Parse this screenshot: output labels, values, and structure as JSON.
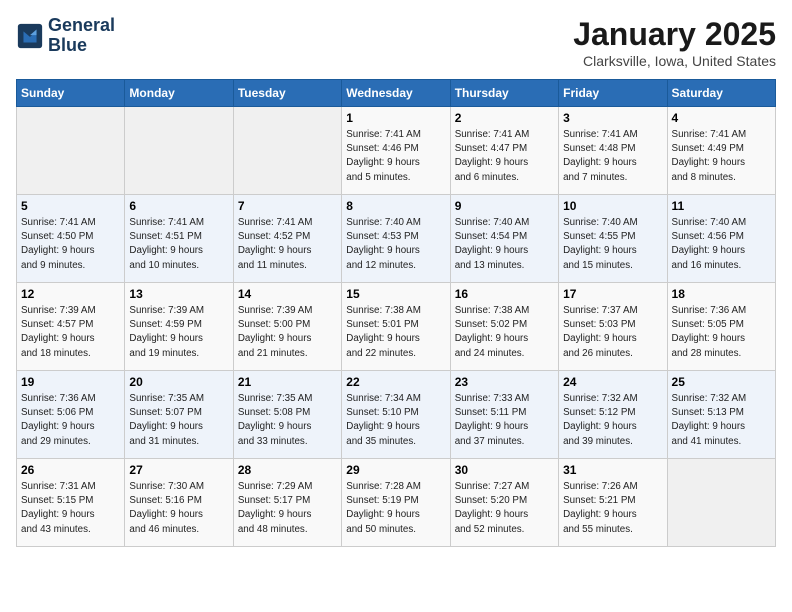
{
  "header": {
    "logo_line1": "General",
    "logo_line2": "Blue",
    "month": "January 2025",
    "location": "Clarksville, Iowa, United States"
  },
  "days_of_week": [
    "Sunday",
    "Monday",
    "Tuesday",
    "Wednesday",
    "Thursday",
    "Friday",
    "Saturday"
  ],
  "weeks": [
    [
      {
        "day": "",
        "info": ""
      },
      {
        "day": "",
        "info": ""
      },
      {
        "day": "",
        "info": ""
      },
      {
        "day": "1",
        "info": "Sunrise: 7:41 AM\nSunset: 4:46 PM\nDaylight: 9 hours\nand 5 minutes."
      },
      {
        "day": "2",
        "info": "Sunrise: 7:41 AM\nSunset: 4:47 PM\nDaylight: 9 hours\nand 6 minutes."
      },
      {
        "day": "3",
        "info": "Sunrise: 7:41 AM\nSunset: 4:48 PM\nDaylight: 9 hours\nand 7 minutes."
      },
      {
        "day": "4",
        "info": "Sunrise: 7:41 AM\nSunset: 4:49 PM\nDaylight: 9 hours\nand 8 minutes."
      }
    ],
    [
      {
        "day": "5",
        "info": "Sunrise: 7:41 AM\nSunset: 4:50 PM\nDaylight: 9 hours\nand 9 minutes."
      },
      {
        "day": "6",
        "info": "Sunrise: 7:41 AM\nSunset: 4:51 PM\nDaylight: 9 hours\nand 10 minutes."
      },
      {
        "day": "7",
        "info": "Sunrise: 7:41 AM\nSunset: 4:52 PM\nDaylight: 9 hours\nand 11 minutes."
      },
      {
        "day": "8",
        "info": "Sunrise: 7:40 AM\nSunset: 4:53 PM\nDaylight: 9 hours\nand 12 minutes."
      },
      {
        "day": "9",
        "info": "Sunrise: 7:40 AM\nSunset: 4:54 PM\nDaylight: 9 hours\nand 13 minutes."
      },
      {
        "day": "10",
        "info": "Sunrise: 7:40 AM\nSunset: 4:55 PM\nDaylight: 9 hours\nand 15 minutes."
      },
      {
        "day": "11",
        "info": "Sunrise: 7:40 AM\nSunset: 4:56 PM\nDaylight: 9 hours\nand 16 minutes."
      }
    ],
    [
      {
        "day": "12",
        "info": "Sunrise: 7:39 AM\nSunset: 4:57 PM\nDaylight: 9 hours\nand 18 minutes."
      },
      {
        "day": "13",
        "info": "Sunrise: 7:39 AM\nSunset: 4:59 PM\nDaylight: 9 hours\nand 19 minutes."
      },
      {
        "day": "14",
        "info": "Sunrise: 7:39 AM\nSunset: 5:00 PM\nDaylight: 9 hours\nand 21 minutes."
      },
      {
        "day": "15",
        "info": "Sunrise: 7:38 AM\nSunset: 5:01 PM\nDaylight: 9 hours\nand 22 minutes."
      },
      {
        "day": "16",
        "info": "Sunrise: 7:38 AM\nSunset: 5:02 PM\nDaylight: 9 hours\nand 24 minutes."
      },
      {
        "day": "17",
        "info": "Sunrise: 7:37 AM\nSunset: 5:03 PM\nDaylight: 9 hours\nand 26 minutes."
      },
      {
        "day": "18",
        "info": "Sunrise: 7:36 AM\nSunset: 5:05 PM\nDaylight: 9 hours\nand 28 minutes."
      }
    ],
    [
      {
        "day": "19",
        "info": "Sunrise: 7:36 AM\nSunset: 5:06 PM\nDaylight: 9 hours\nand 29 minutes."
      },
      {
        "day": "20",
        "info": "Sunrise: 7:35 AM\nSunset: 5:07 PM\nDaylight: 9 hours\nand 31 minutes."
      },
      {
        "day": "21",
        "info": "Sunrise: 7:35 AM\nSunset: 5:08 PM\nDaylight: 9 hours\nand 33 minutes."
      },
      {
        "day": "22",
        "info": "Sunrise: 7:34 AM\nSunset: 5:10 PM\nDaylight: 9 hours\nand 35 minutes."
      },
      {
        "day": "23",
        "info": "Sunrise: 7:33 AM\nSunset: 5:11 PM\nDaylight: 9 hours\nand 37 minutes."
      },
      {
        "day": "24",
        "info": "Sunrise: 7:32 AM\nSunset: 5:12 PM\nDaylight: 9 hours\nand 39 minutes."
      },
      {
        "day": "25",
        "info": "Sunrise: 7:32 AM\nSunset: 5:13 PM\nDaylight: 9 hours\nand 41 minutes."
      }
    ],
    [
      {
        "day": "26",
        "info": "Sunrise: 7:31 AM\nSunset: 5:15 PM\nDaylight: 9 hours\nand 43 minutes."
      },
      {
        "day": "27",
        "info": "Sunrise: 7:30 AM\nSunset: 5:16 PM\nDaylight: 9 hours\nand 46 minutes."
      },
      {
        "day": "28",
        "info": "Sunrise: 7:29 AM\nSunset: 5:17 PM\nDaylight: 9 hours\nand 48 minutes."
      },
      {
        "day": "29",
        "info": "Sunrise: 7:28 AM\nSunset: 5:19 PM\nDaylight: 9 hours\nand 50 minutes."
      },
      {
        "day": "30",
        "info": "Sunrise: 7:27 AM\nSunset: 5:20 PM\nDaylight: 9 hours\nand 52 minutes."
      },
      {
        "day": "31",
        "info": "Sunrise: 7:26 AM\nSunset: 5:21 PM\nDaylight: 9 hours\nand 55 minutes."
      },
      {
        "day": "",
        "info": ""
      }
    ]
  ]
}
